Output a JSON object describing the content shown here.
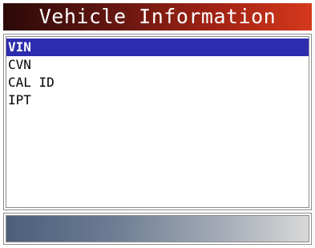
{
  "title": "Vehicle Information",
  "menu": {
    "items": [
      {
        "label": "VIN",
        "selected": true
      },
      {
        "label": "CVN",
        "selected": false
      },
      {
        "label": "CAL ID",
        "selected": false
      },
      {
        "label": "IPT",
        "selected": false
      }
    ]
  },
  "colors": {
    "title_bar_start": "#2b0a08",
    "title_bar_end": "#d6391c",
    "selection": "#2c2cae",
    "status_bar_start": "#4c5e7a",
    "status_bar_end": "#d8d8d8"
  }
}
